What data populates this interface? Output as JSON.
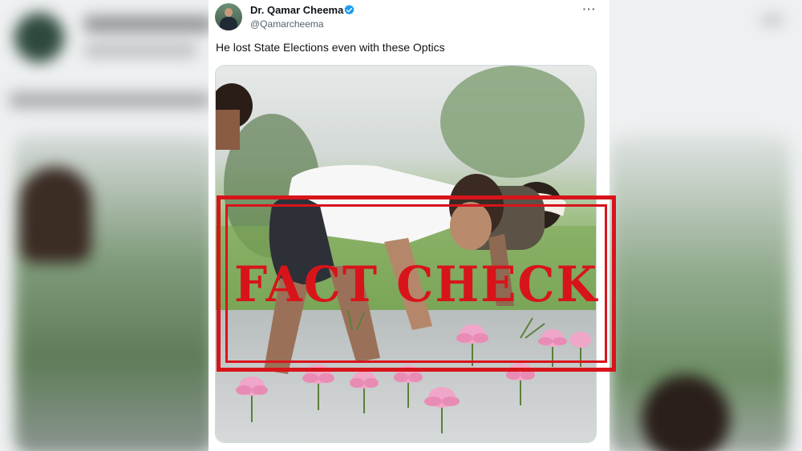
{
  "tweet": {
    "display_name": "Dr. Qamar Cheema",
    "handle": "@Qamarcheema",
    "text": "He lost State Elections even with these Optics",
    "verified": true,
    "more_icon": "more-horizontal-icon"
  },
  "overlay": {
    "stamp_text": "FACT CHECK",
    "stamp_color": "#d8141b"
  },
  "colors": {
    "text_primary": "#0f1419",
    "text_secondary": "#536471",
    "verified_blue": "#1d9bf0"
  }
}
